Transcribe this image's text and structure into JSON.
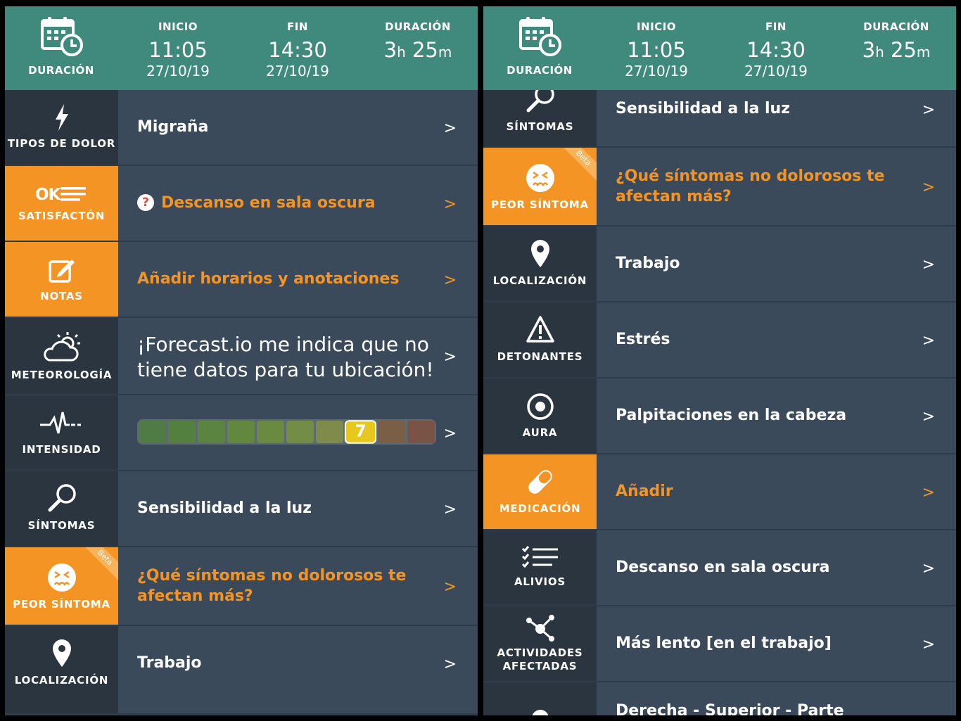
{
  "header": {
    "icon_label": "DURACIÓN",
    "start_label": "INICIO",
    "start_time": "11:05",
    "start_date": "27/10/19",
    "end_label": "FIN",
    "end_time": "14:30",
    "end_date": "27/10/19",
    "duration_label": "DURACIÓN",
    "duration_hours": "3",
    "duration_h_unit": "h",
    "duration_minutes": "25",
    "duration_m_unit": "m"
  },
  "arrow": ">",
  "beta_label": "Beta",
  "left": {
    "pain_type": {
      "label": "TIPOS DE DOLOR",
      "value": "Migraña"
    },
    "satisfaction": {
      "label": "SATISFACTÓN",
      "icon_text": "OK",
      "value": "Descanso en sala oscura",
      "help_glyph": "?"
    },
    "notes": {
      "label": "NOTAS",
      "value": "Añadir horarios y anotaciones"
    },
    "weather": {
      "label": "METEOROLOGÍA",
      "value": "¡Forecast.io me indica que no tiene datos para tu ubicación!"
    },
    "intensity": {
      "label": "INTENSIDAD",
      "value": 7,
      "value_text": "7",
      "scale_max": 10
    },
    "symptoms": {
      "label": "SÍNTOMAS",
      "value": "Sensibilidad a la luz"
    },
    "worst_symptom": {
      "label": "PEOR SÍNTOMA",
      "value": "¿Qué síntomas no dolorosos te afectan más?"
    },
    "location": {
      "label": "LOCALIZACIÓN",
      "value": "Trabajo"
    }
  },
  "right": {
    "symptoms": {
      "label": "SÍNTOMAS",
      "value": "Sensibilidad a la luz"
    },
    "worst_symptom": {
      "label": "PEOR SÍNTOMA",
      "value": "¿Qué síntomas no dolorosos te afectan más?"
    },
    "location": {
      "label": "LOCALIZACIÓN",
      "value": "Trabajo"
    },
    "triggers": {
      "label": "DETONANTES",
      "value": "Estrés"
    },
    "aura": {
      "label": "AURA",
      "value": "Palpitaciones en la cabeza"
    },
    "medication": {
      "label": "MEDICACIÓN",
      "value": "Añadir"
    },
    "reliefs": {
      "label": "ALIVIOS",
      "value": "Descanso en sala oscura"
    },
    "activities": {
      "label": "ACTIVIDADES AFECTADAS",
      "value": "Más lento [en el trabajo]"
    },
    "pain_position": {
      "value": "Derecha - Superior - Parte posterior"
    }
  },
  "colors": {
    "header": "#3f8a7c",
    "sidebar": "#2b3540",
    "content": "#3a4a5a",
    "accent": "#f39425",
    "slider_selected": "#e7c81f"
  },
  "intensity_colors": [
    "#4f7b45",
    "#54803f",
    "#5a843f",
    "#628840",
    "#6a8a42",
    "#738c46",
    "#7f8b4a",
    "#e7c81f",
    "#7a5e45",
    "#7a5347"
  ]
}
